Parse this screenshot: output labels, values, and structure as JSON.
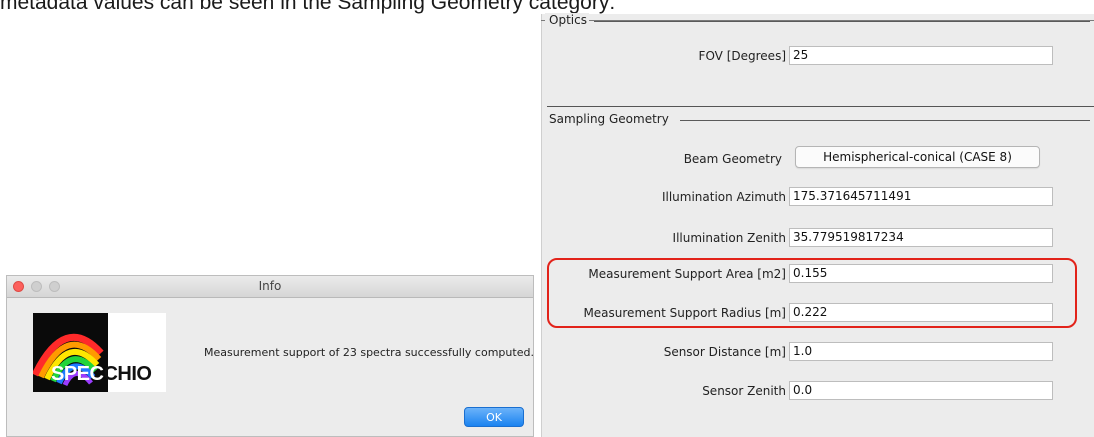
{
  "caption": "metadata values can be seen in the Sampling Geometry category:",
  "optics": {
    "title": "Optics",
    "fov_label": "FOV [Degrees]",
    "fov_value": "25"
  },
  "sampling_geometry": {
    "title": "Sampling Geometry",
    "beam_geometry_label": "Beam Geometry",
    "beam_geometry_value": "Hemispherical-conical (CASE 8)",
    "illumination_azimuth_label": "Illumination Azimuth",
    "illumination_azimuth_value": "175.371645711491",
    "illumination_zenith_label": "Illumination Zenith",
    "illumination_zenith_value": "35.779519817234",
    "support_area_label": "Measurement Support Area [m2]",
    "support_area_value": "0.155",
    "support_radius_label": "Measurement Support Radius [m]",
    "support_radius_value": "0.222",
    "sensor_distance_label": "Sensor Distance [m]",
    "sensor_distance_value": "1.0",
    "sensor_zenith_label": "Sensor Zenith",
    "sensor_zenith_value": "0.0"
  },
  "dialog": {
    "title": "Info",
    "logo_text_a": "SPEC",
    "logo_text_b": "CHIO",
    "message": "Measurement support of 23 spectra successfully computed.",
    "ok_label": "OK"
  },
  "colors": {
    "highlight": "#e2231a",
    "ok_button": "#1b83f0",
    "close_button": "#fc605c"
  },
  "icons": [
    "close-button-icon",
    "minimize-button-icon",
    "zoom-button-icon",
    "specchio-rainbow-logo"
  ]
}
